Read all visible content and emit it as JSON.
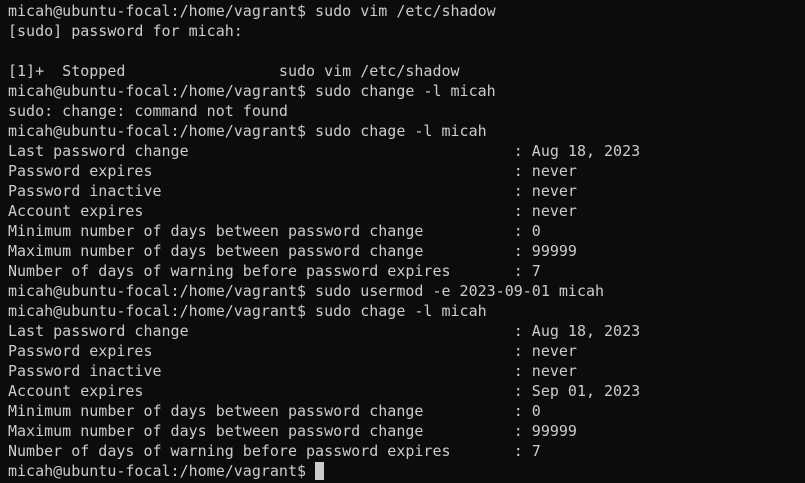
{
  "terminal": {
    "lines": [
      "micah@ubuntu-focal:/home/vagrant$ sudo vim /etc/shadow",
      "[sudo] password for micah:",
      "",
      "[1]+  Stopped                 sudo vim /etc/shadow",
      "micah@ubuntu-focal:/home/vagrant$ sudo change -l micah",
      "sudo: change: command not found",
      "micah@ubuntu-focal:/home/vagrant$ sudo chage -l micah",
      "Last password change                                    : Aug 18, 2023",
      "Password expires                                        : never",
      "Password inactive                                       : never",
      "Account expires                                         : never",
      "Minimum number of days between password change          : 0",
      "Maximum number of days between password change          : 99999",
      "Number of days of warning before password expires       : 7",
      "micah@ubuntu-focal:/home/vagrant$ sudo usermod -e 2023-09-01 micah",
      "micah@ubuntu-focal:/home/vagrant$ sudo chage -l micah",
      "Last password change                                    : Aug 18, 2023",
      "Password expires                                        : never",
      "Password inactive                                       : never",
      "Account expires                                         : Sep 01, 2023",
      "Minimum number of days between password change          : 0",
      "Maximum number of days between password change          : 99999",
      "Number of days of warning before password expires       : 7"
    ],
    "prompt": "micah@ubuntu-focal:/home/vagrant$"
  }
}
